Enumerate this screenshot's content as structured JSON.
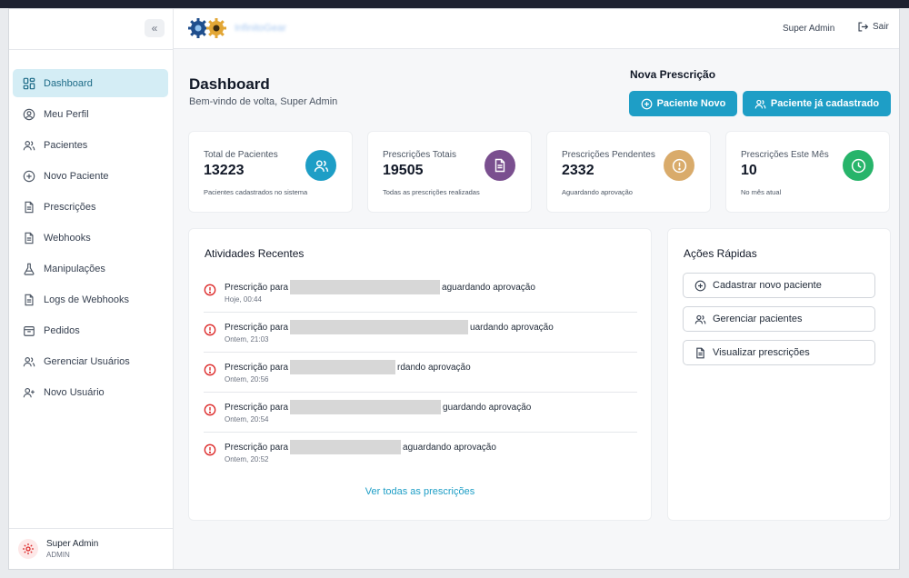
{
  "app": {
    "logo_text": "InfinitoGear"
  },
  "sidebar": {
    "collapse_label": "«",
    "items": [
      {
        "label": "Dashboard",
        "icon": "dashboard-icon",
        "active": true
      },
      {
        "label": "Meu Perfil",
        "icon": "user-circle-icon"
      },
      {
        "label": "Pacientes",
        "icon": "users-icon"
      },
      {
        "label": "Novo Paciente",
        "icon": "plus-circle-icon"
      },
      {
        "label": "Prescrições",
        "icon": "file-icon"
      },
      {
        "label": "Webhooks",
        "icon": "file-icon"
      },
      {
        "label": "Manipulações",
        "icon": "flask-icon"
      },
      {
        "label": "Logs de Webhooks",
        "icon": "file-icon"
      },
      {
        "label": "Pedidos",
        "icon": "box-icon"
      },
      {
        "label": "Gerenciar Usuários",
        "icon": "users-icon"
      },
      {
        "label": "Novo Usuário",
        "icon": "user-plus-icon"
      }
    ],
    "footer": {
      "name": "Super Admin",
      "role": "ADMIN"
    }
  },
  "header": {
    "user_name": "Super Admin",
    "logout_label": "Sair"
  },
  "main": {
    "title": "Dashboard",
    "subtitle": "Bem-vindo de volta, Super Admin",
    "new_prescription": {
      "title": "Nova Prescrição",
      "new_patient_label": "Paciente Novo",
      "existing_patient_label": "Paciente já cadastrado"
    },
    "stats": [
      {
        "label": "Total de Pacientes",
        "value": "13223",
        "desc": "Pacientes cadastrados no sistema",
        "color": "#1e9ec6",
        "icon": "users-icon"
      },
      {
        "label": "Prescrições Totais",
        "value": "19505",
        "desc": "Todas as prescrições realizadas",
        "color": "#7a4f8f",
        "icon": "file-icon"
      },
      {
        "label": "Prescrições Pendentes",
        "value": "2332",
        "desc": "Aguardando aprovação",
        "color": "#d9ab6b",
        "icon": "alert-icon"
      },
      {
        "label": "Prescrições Este Mês",
        "value": "10",
        "desc": "No mês atual",
        "color": "#27b46a",
        "icon": "clock-icon"
      }
    ],
    "activities": {
      "title": "Atividades Recentes",
      "items": [
        {
          "prefix": "Prescrição para",
          "suffix": "aguardando aprovação",
          "time": "Hoje, 00:44"
        },
        {
          "prefix": "Prescrição para",
          "suffix": "uardando aprovação",
          "time": "Ontem, 21:03"
        },
        {
          "prefix": "Prescrição para",
          "suffix": "rdando aprovação",
          "time": "Ontem, 20:56"
        },
        {
          "prefix": "Prescrição para",
          "suffix": "guardando aprovação",
          "time": "Ontem, 20:54"
        },
        {
          "prefix": "Prescrição para",
          "suffix": "aguardando aprovação",
          "time": "Ontem, 20:52"
        }
      ],
      "see_all_label": "Ver todas as prescrições"
    },
    "quick_actions": {
      "title": "Ações Rápidas",
      "items": [
        {
          "label": "Cadastrar novo paciente",
          "icon": "plus-circle-icon"
        },
        {
          "label": "Gerenciar pacientes",
          "icon": "users-icon"
        },
        {
          "label": "Visualizar prescrições",
          "icon": "file-icon"
        }
      ]
    }
  },
  "colors": {
    "accent": "#1e9ec6",
    "alert": "#dc2626",
    "active_bg": "#d4edf5"
  }
}
